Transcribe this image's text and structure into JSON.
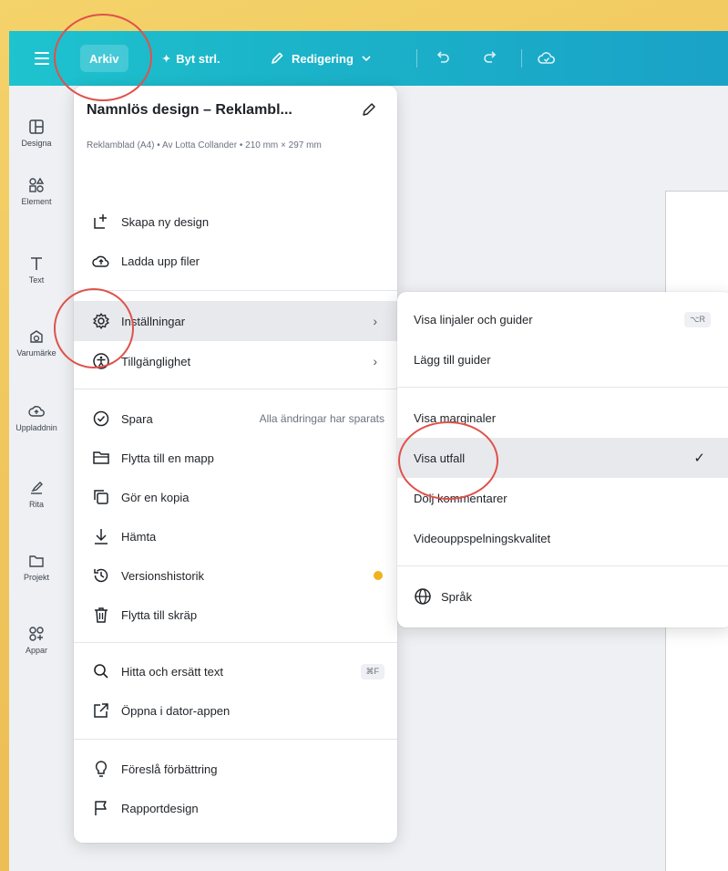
{
  "topbar": {
    "arkiv_label": "Arkiv",
    "byt_label": "Byt strl.",
    "redigering_label": "Redigering"
  },
  "sidebar": {
    "items": [
      {
        "label": "Designa",
        "icon": "layout-icon"
      },
      {
        "label": "Element",
        "icon": "shapes-icon"
      },
      {
        "label": "Text",
        "icon": "text-icon"
      },
      {
        "label": "Varumärke",
        "icon": "brand-icon"
      },
      {
        "label": "Uppladdnin",
        "icon": "cloud-upload-icon"
      },
      {
        "label": "Rita",
        "icon": "draw-icon"
      },
      {
        "label": "Projekt",
        "icon": "folder-icon"
      },
      {
        "label": "Appar",
        "icon": "apps-icon"
      }
    ]
  },
  "menu": {
    "title": "Namnlös design – Reklambl...",
    "subtitle": "Reklamblad (A4) • Av Lotta Collander • 210 mm × 297 mm",
    "items": {
      "new_design": "Skapa ny design",
      "upload": "Ladda upp filer",
      "settings": "Inställningar",
      "accessibility": "Tillgänglighet",
      "save": "Spara",
      "save_status": "Alla ändringar har sparats",
      "move_folder": "Flytta till en mapp",
      "copy": "Gör en kopia",
      "download": "Hämta",
      "version_history": "Versionshistorik",
      "trash": "Flytta till skräp",
      "find_replace": "Hitta och ersätt text",
      "find_replace_shortcut": "⌘F",
      "open_desktop": "Öppna i dator-appen",
      "suggest": "Föreslå förbättring",
      "report": "Rapportdesign"
    }
  },
  "submenu": {
    "rulers": "Visa linjaler och guider",
    "rulers_shortcut": "⌥R",
    "add_guides": "Lägg till guider",
    "margins": "Visa marginaler",
    "bleed": "Visa utfall",
    "hide_comments": "Dölj kommentarer",
    "video_quality": "Videouppspelningskvalitet",
    "language": "Språk"
  },
  "colors": {
    "topbar_start": "#1ec3cf",
    "topbar_end": "#1aa2c7",
    "annotation_circle": "#e0514b",
    "highlight": "#e7e9ed"
  }
}
